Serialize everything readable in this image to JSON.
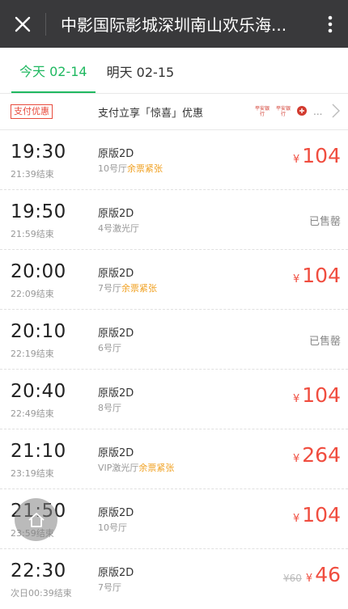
{
  "header": {
    "title": "中影国际影城深圳南山欢乐海...",
    "close_icon": "close-icon",
    "more_icon": "more-vertical-icon"
  },
  "tabs": [
    {
      "label": "今天 02-14",
      "active": true
    },
    {
      "label": "明天 02-15",
      "active": false
    }
  ],
  "promo": {
    "badge": "支付优惠",
    "text": "支付立享「惊喜」优惠",
    "bank_logos": [
      "平安银行",
      "平安银行"
    ],
    "ellipsis": "..."
  },
  "sessions": [
    {
      "time": "19:30",
      "end": "21:39结束",
      "version": "原版2D",
      "hall": "10号厅",
      "tag": "余票紧张",
      "price": "104",
      "currency": "¥"
    },
    {
      "time": "19:50",
      "end": "21:59结束",
      "version": "原版2D",
      "hall": "4号激光厅",
      "tag": "",
      "sold": "已售罄"
    },
    {
      "time": "20:00",
      "end": "22:09结束",
      "version": "原版2D",
      "hall": "7号厅",
      "tag": "余票紧张",
      "price": "104",
      "currency": "¥"
    },
    {
      "time": "20:10",
      "end": "22:19结束",
      "version": "原版2D",
      "hall": "6号厅",
      "tag": "",
      "sold": "已售罄"
    },
    {
      "time": "20:40",
      "end": "22:49结束",
      "version": "原版2D",
      "hall": "8号厅",
      "tag": "",
      "price": "104",
      "currency": "¥"
    },
    {
      "time": "21:10",
      "end": "23:19结束",
      "version": "原版2D",
      "hall": "VIP激光厅",
      "tag": "余票紧张",
      "price": "264",
      "currency": "¥"
    },
    {
      "time": "21:50",
      "end": "23:59结束",
      "version": "原版2D",
      "hall": "10号厅",
      "tag": "",
      "price": "104",
      "currency": "¥"
    },
    {
      "time": "22:30",
      "end": "次日00:39结束",
      "version": "原版2D",
      "hall": "7号厅",
      "tag": "",
      "original_price": "¥60",
      "price": "46",
      "currency": "¥"
    }
  ],
  "colors": {
    "accent": "#1fb860",
    "price": "#f04d3f",
    "tight": "#f0a020",
    "header": "#39393b"
  }
}
